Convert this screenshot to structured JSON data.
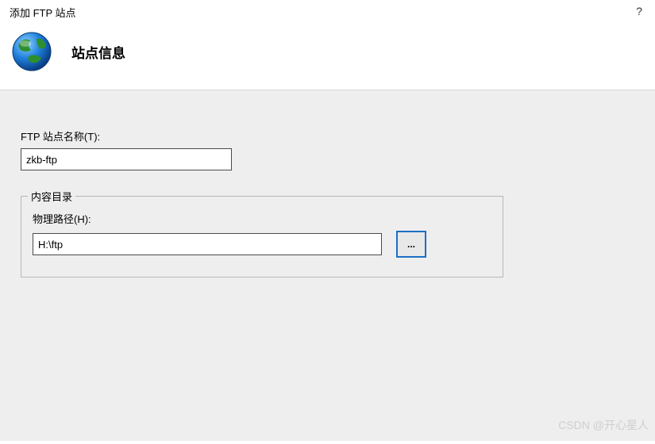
{
  "window": {
    "title": "添加 FTP 站点",
    "help_label": "?"
  },
  "header": {
    "icon": "globe-icon",
    "heading": "站点信息"
  },
  "form": {
    "site_name_label": "FTP 站点名称(T):",
    "site_name_value": "zkb-ftp",
    "content_dir_legend": "内容目录",
    "physical_path_label": "物理路径(H):",
    "physical_path_value": "H:\\ftp",
    "browse_button_label": "..."
  },
  "watermark": "CSDN @开心星人"
}
